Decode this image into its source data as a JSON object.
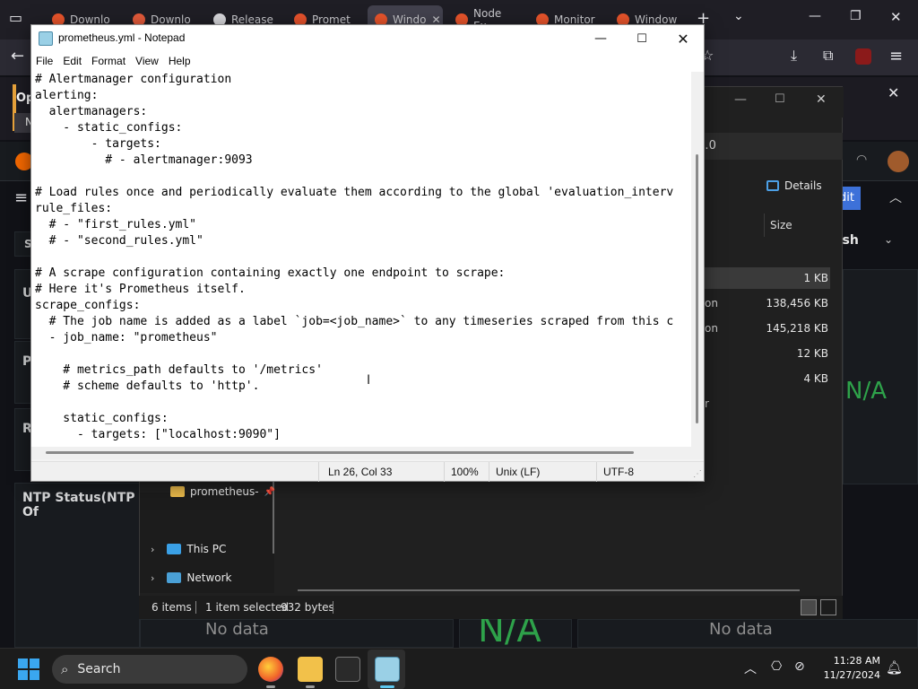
{
  "browser": {
    "tabs": [
      {
        "label": "Downlo"
      },
      {
        "label": "Downlo"
      },
      {
        "label": "Release"
      },
      {
        "label": "Promet"
      },
      {
        "label": "Windo"
      },
      {
        "label": "Node Ex"
      },
      {
        "label": "Monitor"
      },
      {
        "label": "Window"
      }
    ],
    "notif_prefix": "Op",
    "notif_sub": "N"
  },
  "grafana": {
    "edit_label": "dit",
    "refresh_label": "esh",
    "panel_labels": [
      "S",
      "U",
      "P",
      "R"
    ],
    "ntp_title": "NTP Status(NTP Of",
    "na_value": "N/A",
    "no_data": "No data"
  },
  "explorer": {
    "search_placeholder": "Search prometheus-3.0.0",
    "details_label": "Details",
    "size_header": "Size",
    "file_sizes": [
      "1 KB",
      "138,456 KB",
      "145,218 KB",
      "12 KB",
      "4 KB"
    ],
    "file_type_fragments": [
      "on",
      "on",
      "r"
    ],
    "sidebar": [
      {
        "label": "prometheus-"
      },
      {
        "label": "This PC"
      },
      {
        "label": "Network"
      }
    ],
    "status": {
      "items": "6 items",
      "selected": "1 item selected",
      "size": "932 bytes"
    }
  },
  "notepad": {
    "title": "prometheus.yml - Notepad",
    "menu": [
      "File",
      "Edit",
      "Format",
      "View",
      "Help"
    ],
    "content": "# Alertmanager configuration\nalerting:\n  alertmanagers:\n    - static_configs:\n        - targets:\n          # - alertmanager:9093\n\n# Load rules once and periodically evaluate them according to the global 'evaluation_interv\nrule_files:\n  # - \"first_rules.yml\"\n  # - \"second_rules.yml\"\n\n# A scrape configuration containing exactly one endpoint to scrape:\n# Here it's Prometheus itself.\nscrape_configs:\n  # The job name is added as a label `job=<job_name>` to any timeseries scraped from this c\n  - job_name: \"prometheus\"\n\n    # metrics_path defaults to '/metrics'\n    # scheme defaults to 'http'.\n\n    static_configs:\n      - targets: [\"localhost:9090\"]",
    "status": {
      "position": "Ln 26, Col 33",
      "zoom": "100%",
      "line_ending": "Unix (LF)",
      "encoding": "UTF-8"
    }
  },
  "taskbar": {
    "search_label": "Search",
    "time": "11:28 AM",
    "date": "11/27/2024"
  },
  "icons": {
    "start": "windows-start-icon",
    "firefox": "firefox-icon",
    "explorer": "file-explorer-icon",
    "terminal": "terminal-icon",
    "notepad": "notepad-icon"
  }
}
